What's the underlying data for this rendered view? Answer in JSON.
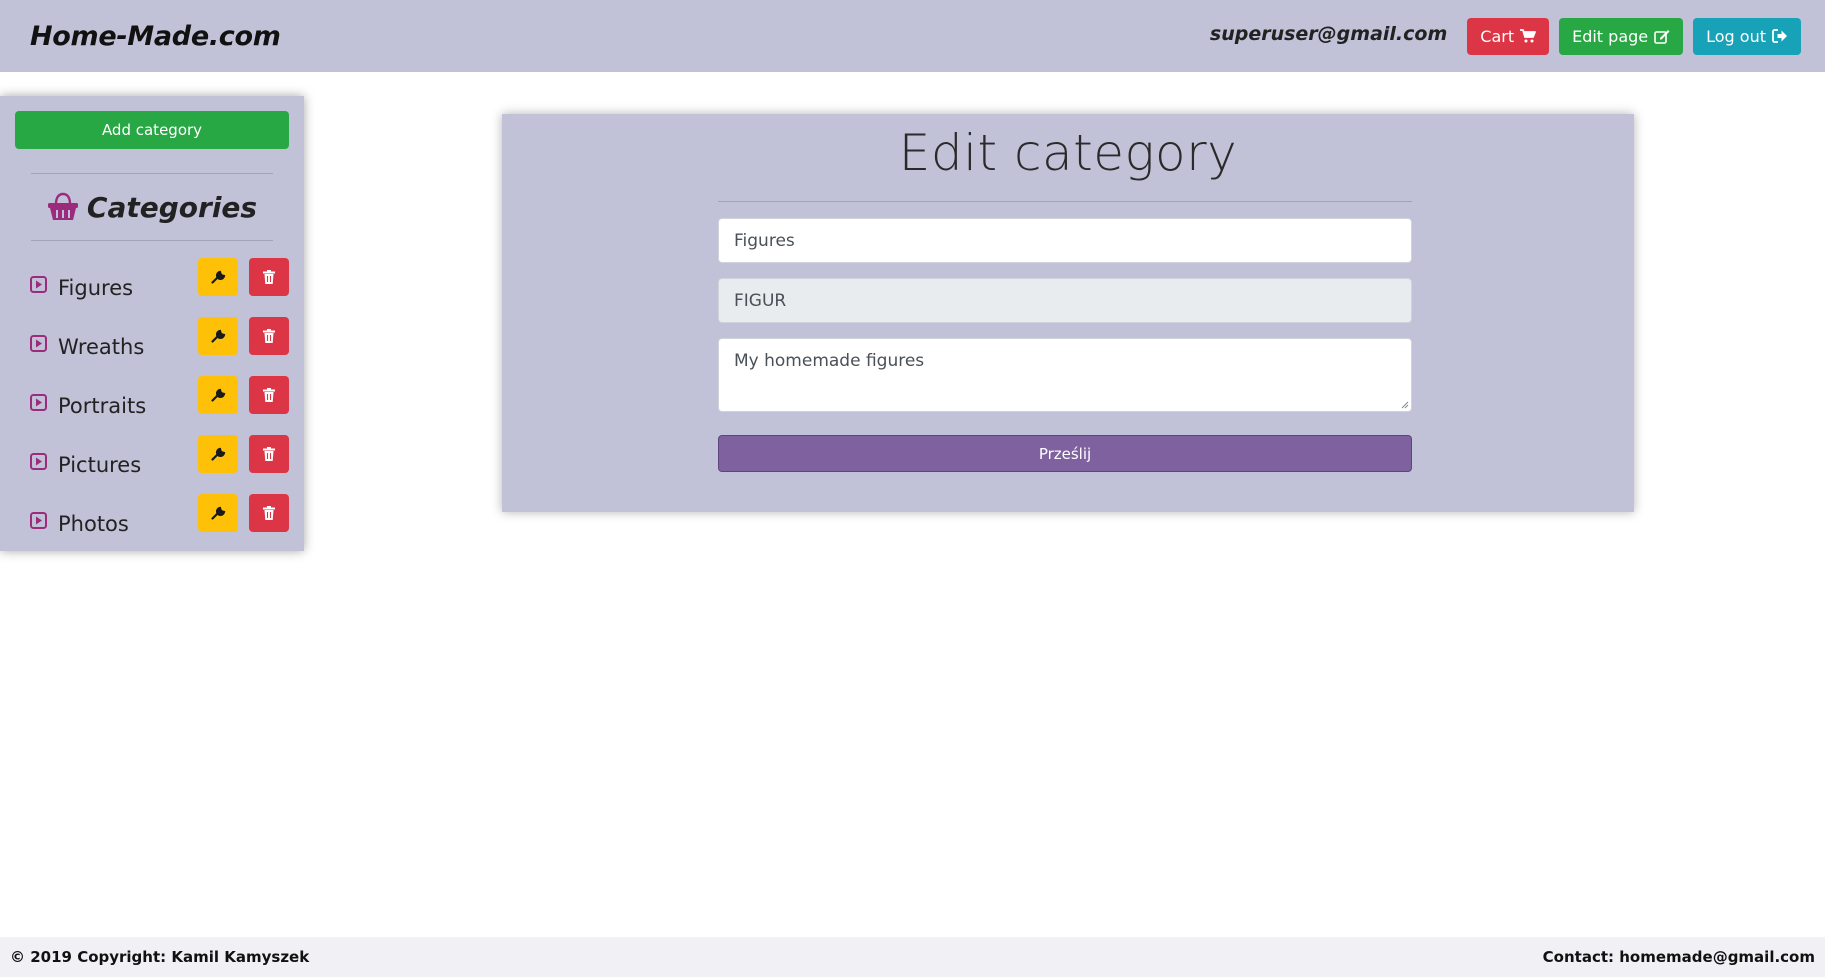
{
  "navbar": {
    "brand": "Home-Made.com",
    "user_email": "superuser@gmail.com",
    "cart_label": "Cart",
    "edit_page_label": "Edit page",
    "logout_label": "Log out",
    "icons": {
      "cart": "shopping-cart-icon",
      "edit": "edit-icon",
      "logout": "sign-out-icon"
    }
  },
  "sidebar": {
    "add_category_label": "Add category",
    "heading": "Categories",
    "heading_icon": "basket-icon",
    "items": [
      {
        "label": "Figures"
      },
      {
        "label": "Wreaths"
      },
      {
        "label": "Portraits"
      },
      {
        "label": "Pictures"
      },
      {
        "label": "Photos"
      }
    ],
    "icons": {
      "item": "play-square-icon",
      "edit": "wrench-icon",
      "delete": "trash-icon"
    }
  },
  "form": {
    "title": "Edit category",
    "name_value": "Figures",
    "code_value": "FIGUR",
    "description_value": "My homemade figures",
    "submit_label": "Prześlij"
  },
  "footer": {
    "copyright": "© 2019 Copyright: Kamil Kamyszek",
    "contact": "Contact: homemade@gmail.com"
  },
  "colors": {
    "panel": "#c1c1d7",
    "danger": "#dc3545",
    "success": "#28a745",
    "info": "#17a2b8",
    "warning": "#ffc107",
    "submit": "#7f61a0",
    "accent_icon": "#9b2c7c"
  }
}
